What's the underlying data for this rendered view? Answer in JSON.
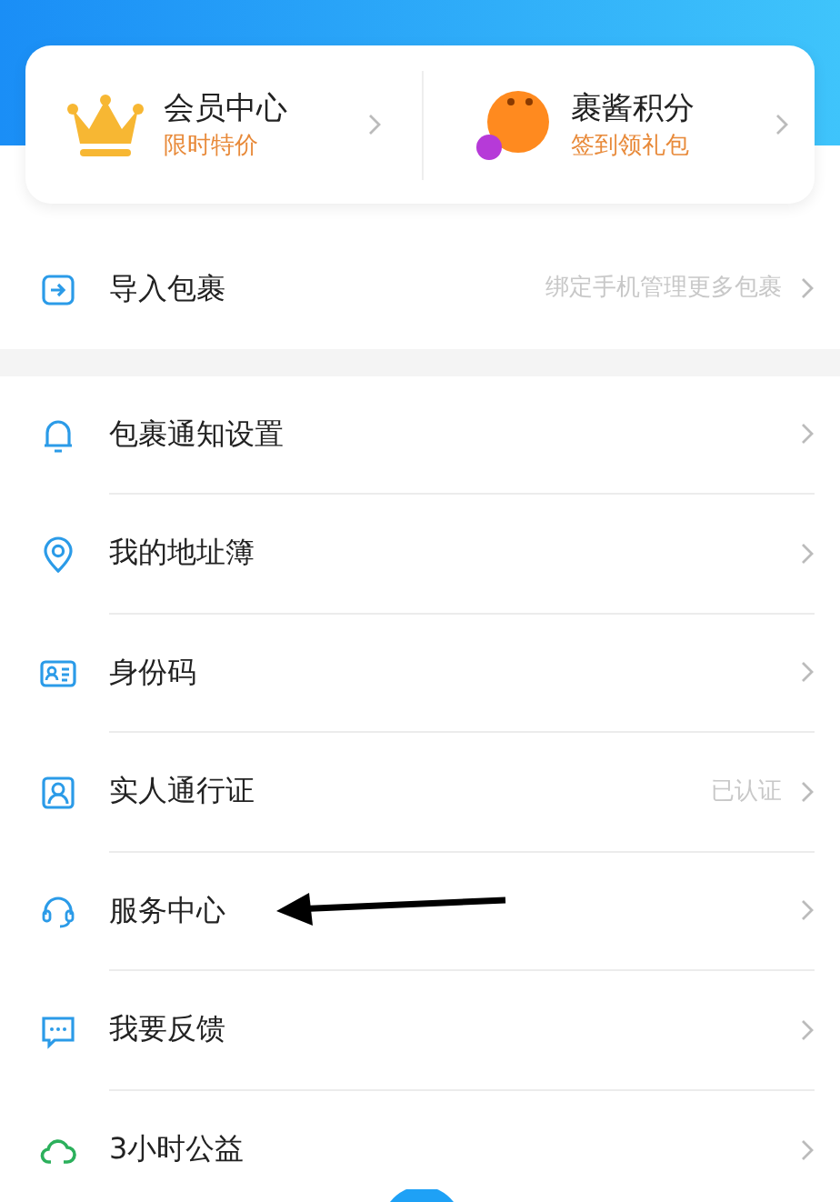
{
  "cards": [
    {
      "title": "会员中心",
      "subtitle": "限时特价"
    },
    {
      "title": "裹酱积分",
      "subtitle": "签到领礼包"
    }
  ],
  "menu_groups": [
    {
      "items": [
        {
          "label": "导入包裹",
          "detail": "绑定手机管理更多包裹"
        }
      ]
    },
    {
      "items": [
        {
          "label": "包裹通知设置"
        },
        {
          "label": "我的地址簿"
        },
        {
          "label": "身份码"
        },
        {
          "label": "实人通行证",
          "detail": "已认证"
        },
        {
          "label": "服务中心"
        },
        {
          "label": "我要反馈"
        },
        {
          "label": "3小时公益"
        }
      ]
    }
  ]
}
